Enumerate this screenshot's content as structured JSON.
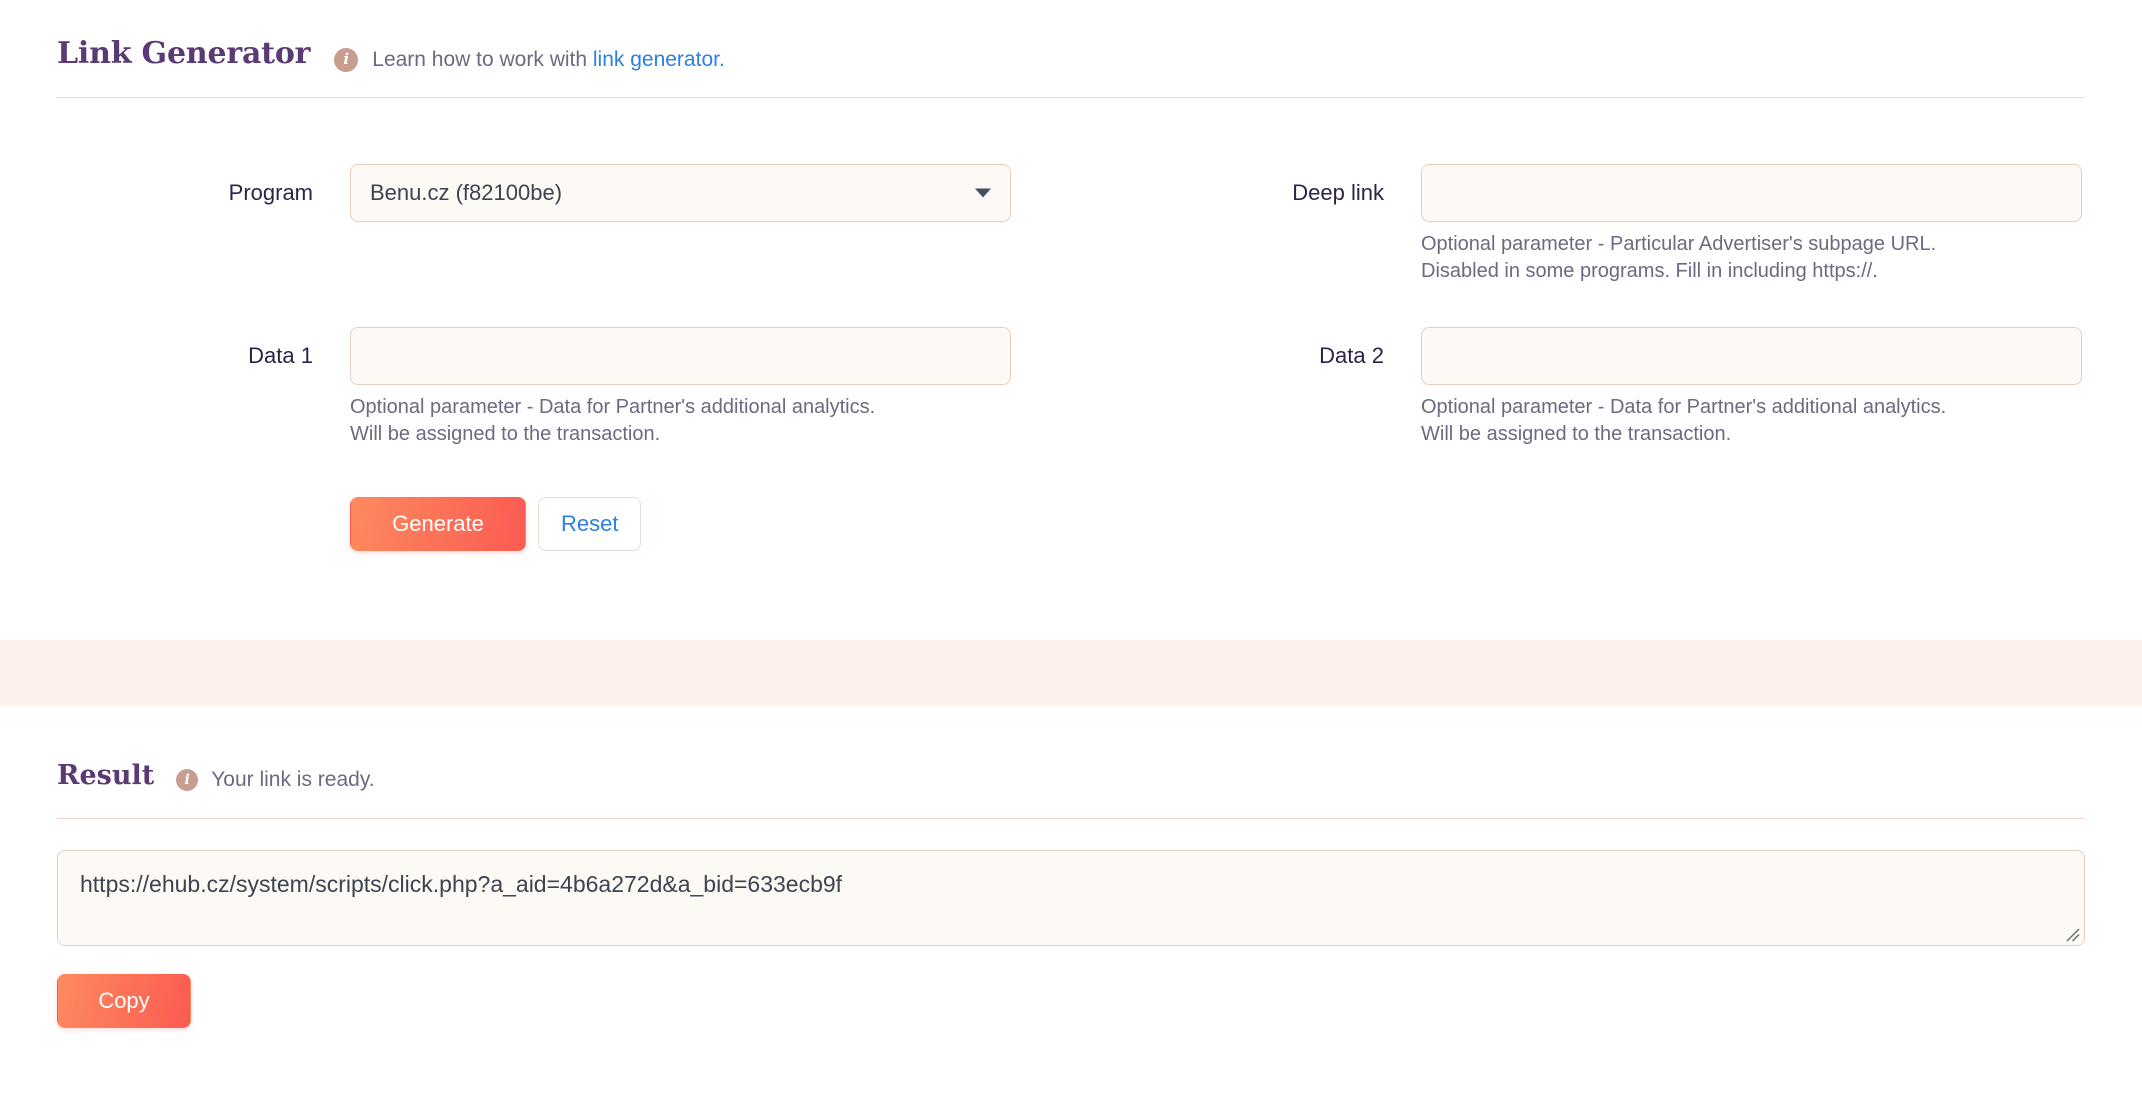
{
  "generator": {
    "title": "Link Generator",
    "info_icon": "info-icon",
    "note_prefix": "Learn how to work with ",
    "note_link": "link generator.",
    "link_color": "#2d7fe0"
  },
  "form": {
    "program": {
      "label": "Program",
      "value": "Benu.cz (f82100be)",
      "arrow_icon": "chevron-down-icon"
    },
    "deep_link": {
      "label": "Deep link",
      "value": "",
      "placeholder": "",
      "help_line1": "Optional parameter - Particular Advertiser's subpage URL.",
      "help_line2": "Disabled in some programs. Fill in including https://."
    },
    "data1": {
      "label": "Data 1",
      "value": "",
      "placeholder": "",
      "help_line1": "Optional parameter - Data for Partner's additional analytics.",
      "help_line2": "Will be assigned to the transaction."
    },
    "data2": {
      "label": "Data 2",
      "value": "",
      "placeholder": "",
      "help_line1": "Optional parameter - Data for Partner's additional analytics.",
      "help_line2": "Will be assigned to the transaction."
    },
    "generate_label": "Generate",
    "reset_label": "Reset"
  },
  "result": {
    "title": "Result",
    "info_icon": "info-icon",
    "note": "Your link is ready.",
    "link": "https://ehub.cz/system/scripts/click.php?a_aid=4b6a272d&a_bid=633ecb9f",
    "copy_label": "Copy",
    "resize_icon": "resize-grip-icon"
  },
  "colors": {
    "heading": "#5b3a73",
    "accent_start": "#fd8a5e",
    "accent_end": "#fb5b52",
    "band": "#fdf1ec",
    "field_bg": "#fdf9f5",
    "field_border": "#e9cfc0"
  }
}
